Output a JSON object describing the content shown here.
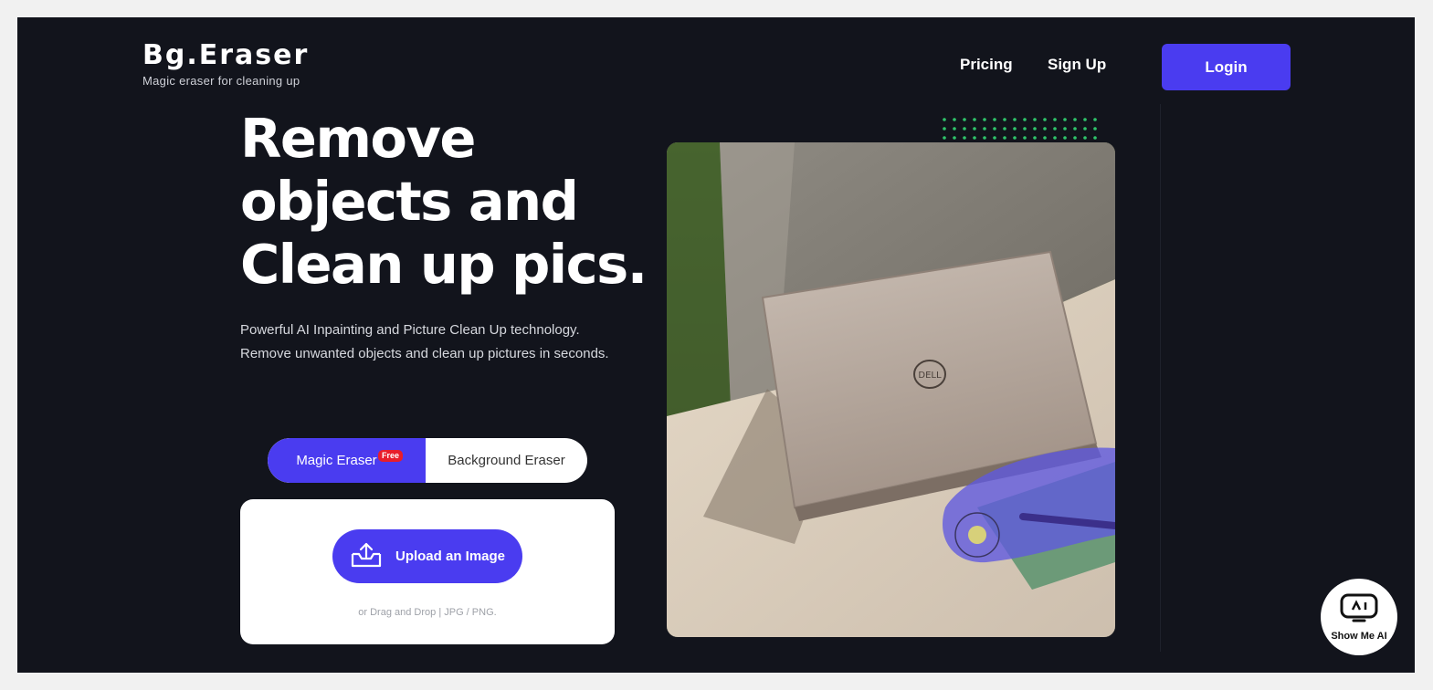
{
  "header": {
    "logo_title": "Bg.Eraser",
    "logo_subtitle": "Magic eraser for cleaning up",
    "nav": {
      "pricing": "Pricing",
      "signup": "Sign Up",
      "login": "Login"
    }
  },
  "hero": {
    "title_lines": [
      "Remove",
      "objects and",
      "Clean up pics."
    ],
    "description": "Powerful AI Inpainting and Picture Clean Up technology. Remove unwanted objects and clean up pictures in seconds."
  },
  "toggle": {
    "magic_eraser": "Magic Eraser",
    "free_badge": "Free",
    "background_eraser": "Background Eraser",
    "selected": "Magic Eraser"
  },
  "upload": {
    "button_label": "Upload an Image",
    "hint": "or Drag and Drop | JPG / PNG."
  },
  "mascot": {
    "label": "Show Me AI"
  },
  "colors": {
    "accent": "#4a3cf0",
    "background": "#12141c",
    "badge_red": "#e81d2b",
    "dots_green": "#2fc46a"
  },
  "icons": {
    "upload": "upload-tray-icon",
    "mascot": "robot-face-icon"
  }
}
